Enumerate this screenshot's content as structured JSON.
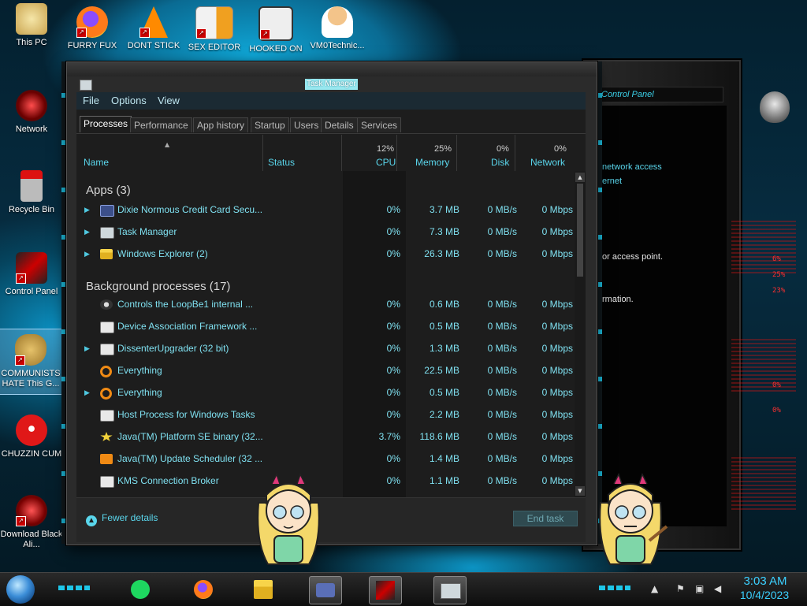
{
  "desktop": {
    "top_icons": [
      {
        "label": "This PC"
      },
      {
        "label": "FURRY FUX"
      },
      {
        "label": "DONT STICK"
      },
      {
        "label": "SEX EDITOR"
      },
      {
        "label": "HOOKED ON"
      },
      {
        "label": "VM0Technic..."
      }
    ],
    "left_icons": [
      {
        "label": "Network"
      },
      {
        "label": "Recycle Bin"
      },
      {
        "label": "Control Panel"
      },
      {
        "label": "COMMUNISTS HATE This G..."
      },
      {
        "label": "CHUZZIN CUM"
      },
      {
        "label": "Download Black Ali..."
      }
    ]
  },
  "control_panel_bg": {
    "address": "Control Panel",
    "texts": [
      "network access",
      "ernet",
      "or access point.",
      "rmation."
    ],
    "gauge_values": [
      "6%",
      "25%",
      "23%",
      "0%",
      "0%"
    ]
  },
  "task_manager": {
    "title": "Task Manager",
    "menu": [
      "File",
      "Options",
      "View"
    ],
    "tabs": [
      "Processes",
      "Performance",
      "App history",
      "Startup",
      "Users",
      "Details",
      "Services"
    ],
    "columns": {
      "name": "Name",
      "status": "Status",
      "cpu": {
        "pct": "12%",
        "label": "CPU"
      },
      "memory": {
        "pct": "25%",
        "label": "Memory"
      },
      "disk": {
        "pct": "0%",
        "label": "Disk"
      },
      "network": {
        "pct": "0%",
        "label": "Network"
      }
    },
    "groups": {
      "apps": "Apps (3)",
      "background": "Background processes (17)"
    },
    "apps": [
      {
        "name": "Dixie Normous Credit Card Secu...",
        "cpu": "0%",
        "memory": "3.7 MB",
        "disk": "0 MB/s",
        "network": "0 Mbps",
        "icon": "card-icon",
        "expandable": true
      },
      {
        "name": "Task Manager",
        "cpu": "0%",
        "memory": "7.3 MB",
        "disk": "0 MB/s",
        "network": "0 Mbps",
        "icon": "task-manager-icon",
        "expandable": true
      },
      {
        "name": "Windows Explorer (2)",
        "cpu": "0%",
        "memory": "26.3 MB",
        "disk": "0 MB/s",
        "network": "0 Mbps",
        "icon": "folder-icon",
        "expandable": true
      }
    ],
    "background": [
      {
        "name": "Controls the LoopBe1 internal ...",
        "cpu": "0%",
        "memory": "0.6 MB",
        "disk": "0 MB/s",
        "network": "0 Mbps",
        "icon": "loop-icon",
        "expandable": false
      },
      {
        "name": "Device Association Framework ...",
        "cpu": "0%",
        "memory": "0.5 MB",
        "disk": "0 MB/s",
        "network": "0 Mbps",
        "icon": "window-icon",
        "expandable": false
      },
      {
        "name": "DissenterUpgrader (32 bit)",
        "cpu": "0%",
        "memory": "1.3 MB",
        "disk": "0 MB/s",
        "network": "0 Mbps",
        "icon": "window-icon",
        "expandable": true
      },
      {
        "name": "Everything",
        "cpu": "0%",
        "memory": "22.5 MB",
        "disk": "0 MB/s",
        "network": "0 Mbps",
        "icon": "magnifier-icon",
        "expandable": false
      },
      {
        "name": "Everything",
        "cpu": "0%",
        "memory": "0.5 MB",
        "disk": "0 MB/s",
        "network": "0 Mbps",
        "icon": "magnifier-icon",
        "expandable": true
      },
      {
        "name": "Host Process for Windows Tasks",
        "cpu": "0%",
        "memory": "2.2 MB",
        "disk": "0 MB/s",
        "network": "0 Mbps",
        "icon": "window-icon",
        "expandable": false
      },
      {
        "name": "Java(TM) Platform SE binary (32...",
        "cpu": "3.7%",
        "memory": "118.6 MB",
        "disk": "0 MB/s",
        "network": "0 Mbps",
        "icon": "star-icon",
        "expandable": false
      },
      {
        "name": "Java(TM) Update Scheduler (32 ...",
        "cpu": "0%",
        "memory": "1.4 MB",
        "disk": "0 MB/s",
        "network": "0 Mbps",
        "icon": "java-icon",
        "expandable": false
      },
      {
        "name": "KMS Connection Broker",
        "cpu": "0%",
        "memory": "1.1 MB",
        "disk": "0 MB/s",
        "network": "0 Mbps",
        "icon": "window-icon",
        "expandable": false
      }
    ],
    "fewer_details": "Fewer details",
    "end_task": "End task"
  },
  "taskbar": {
    "time": "3:03 AM",
    "date": "10/4/2023",
    "apps": [
      "spotify-icon",
      "firefox-icon",
      "file-explorer-icon",
      "card-app-icon",
      "control-panel-icon",
      "task-manager-icon"
    ]
  },
  "colors": {
    "accent": "#5ad6ec",
    "process_text": "#7fe0f0",
    "clock": "#3bd0ff"
  }
}
